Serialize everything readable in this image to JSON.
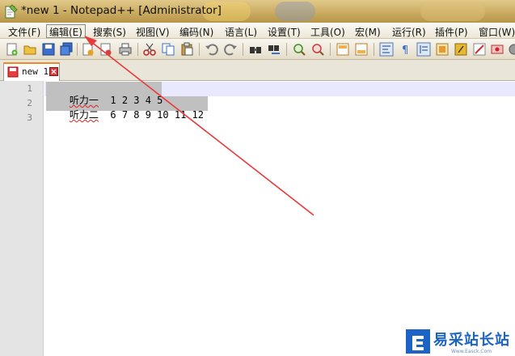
{
  "window": {
    "title": "*new 1 - Notepad++ [Administrator]"
  },
  "menu": {
    "items": [
      {
        "label": "文件(F)"
      },
      {
        "label": "编辑(E)",
        "active": true
      },
      {
        "label": "搜索(S)"
      },
      {
        "label": "视图(V)"
      },
      {
        "label": "编码(N)"
      },
      {
        "label": "语言(L)"
      },
      {
        "label": "设置(T)"
      },
      {
        "label": "工具(O)"
      },
      {
        "label": "宏(M)"
      },
      {
        "label": "运行(R)"
      },
      {
        "label": "插件(P)"
      },
      {
        "label": "窗口(W)"
      }
    ]
  },
  "toolbar": {
    "icons": [
      "new-file-icon",
      "open-file-icon",
      "save-icon",
      "save-all-icon",
      "close-icon",
      "close-all-icon",
      "print-icon",
      "cut-icon",
      "copy-icon",
      "paste-icon",
      "undo-icon",
      "redo-icon",
      "find-icon",
      "replace-icon",
      "zoom-in-icon",
      "zoom-out-icon",
      "sync-vertical-icon",
      "sync-horizontal-icon",
      "word-wrap-icon",
      "show-all-chars-icon",
      "indent-guide-icon",
      "doc-map-icon",
      "function-list-icon",
      "folder-workspace-icon",
      "record-macro-icon",
      "stop-record-icon"
    ]
  },
  "tabs": [
    {
      "label": "new 1"
    }
  ],
  "editor": {
    "lines": [
      {
        "number": "1",
        "label": "听力一",
        "values": "1 2 3 4 5"
      },
      {
        "number": "2",
        "label": "听力二",
        "values": "6 7 8 9 10 11 12"
      },
      {
        "number": "3",
        "label": "",
        "values": ""
      }
    ]
  },
  "watermark": {
    "text": "易采站长站",
    "subtext": "Www.Easck.Com"
  },
  "colors": {
    "accent_orange": "#f08a24",
    "selection": "#c0c0c0",
    "current_line": "#e8e8ff",
    "annotation_arrow": "#e83a3a",
    "watermark_blue": "#1b63c4"
  }
}
